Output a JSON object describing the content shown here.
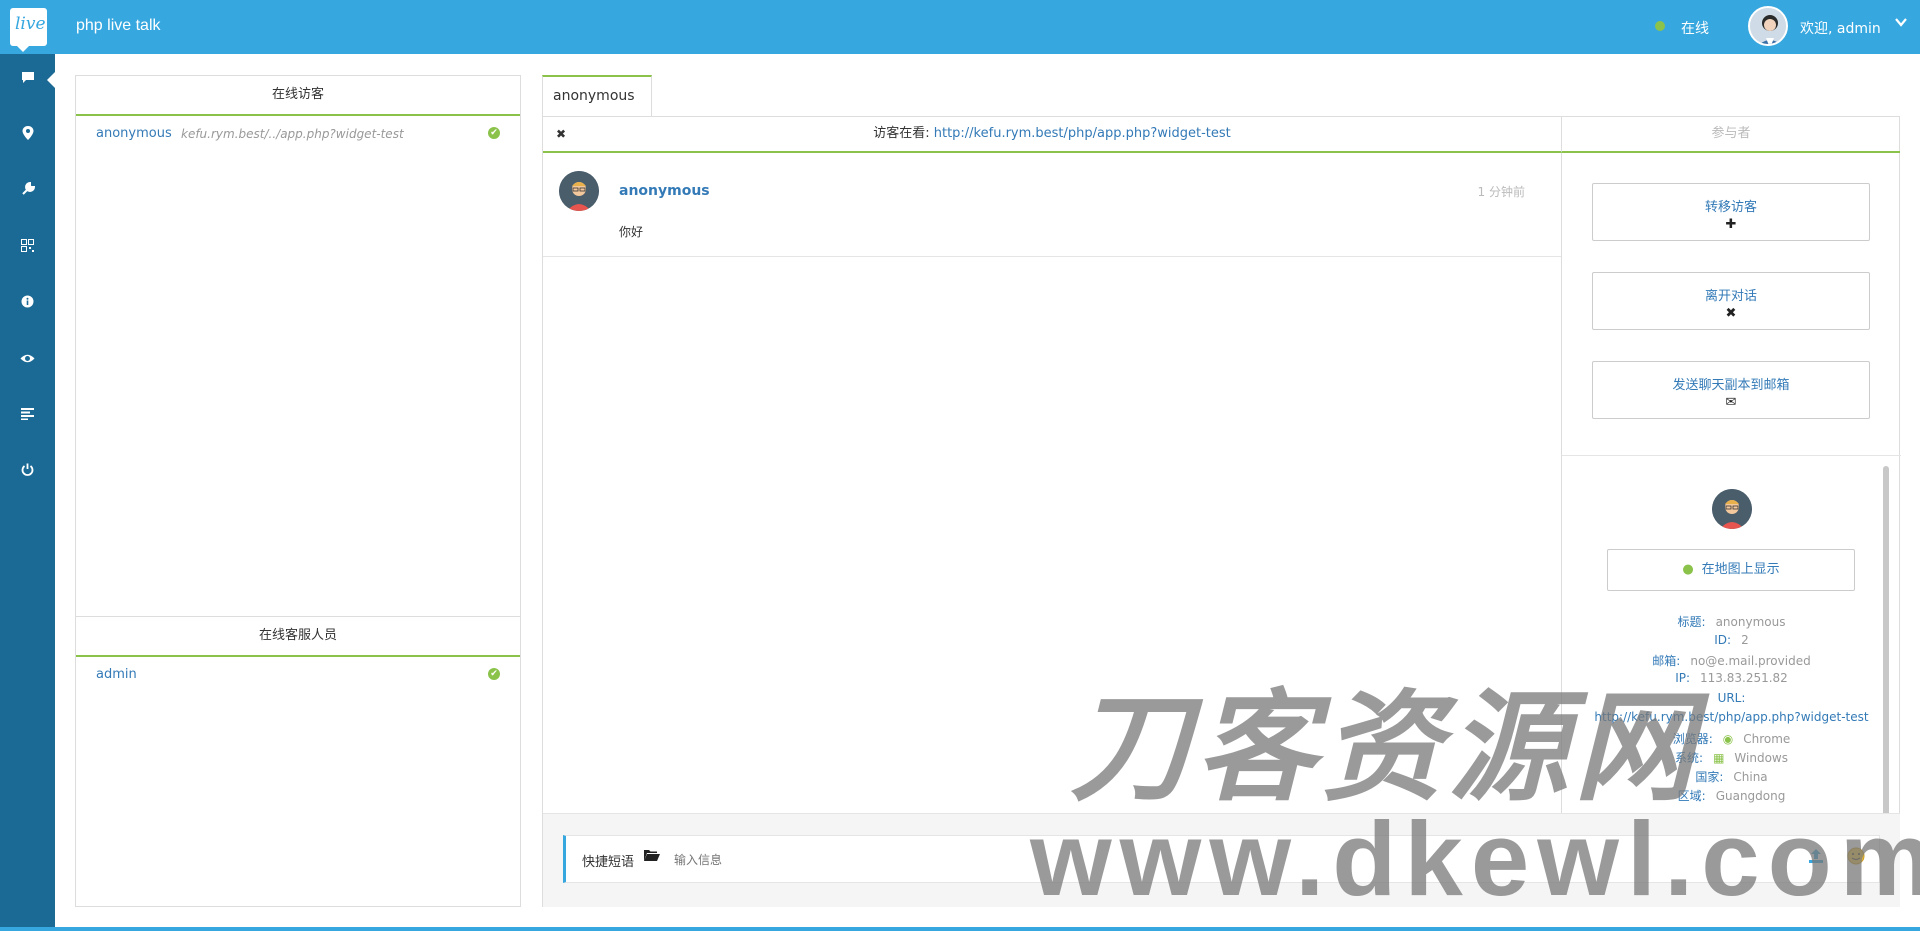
{
  "header": {
    "logo_text": "live",
    "app_title": "php live talk",
    "status": "在线",
    "welcome": "欢迎, admin",
    "chevron": "⌄"
  },
  "sidebar": {
    "items": [
      {
        "icon": "chat-icon",
        "glyph": "▬"
      },
      {
        "icon": "map-pin-icon",
        "glyph": "⚲"
      },
      {
        "icon": "wrench-icon",
        "glyph": "✎"
      },
      {
        "icon": "qr-code-icon",
        "glyph": "▦"
      },
      {
        "icon": "info-icon",
        "glyph": "ⓘ"
      },
      {
        "icon": "eye-icon",
        "glyph": "◉"
      },
      {
        "icon": "list-icon",
        "glyph": "≡"
      },
      {
        "icon": "power-icon",
        "glyph": "⏻"
      }
    ]
  },
  "visitors_panel": {
    "title": "在线访客",
    "items": [
      {
        "name": "anonymous",
        "url": "kefu.rym.best/../app.php?widget-test"
      }
    ]
  },
  "staff_panel": {
    "title": "在线客服人员",
    "items": [
      {
        "name": "admin"
      }
    ]
  },
  "chat": {
    "tab_label": "anonymous",
    "tab_close": "✖",
    "viewing_label": "访客在看:",
    "viewing_url": "http://kefu.rym.best/php/app.php?widget-test",
    "participants_label": "参与者",
    "messages": [
      {
        "name": "anonymous",
        "time": "1 分钟前",
        "text": "你好"
      }
    ]
  },
  "actions": {
    "transfer": {
      "label": "转移访客",
      "glyph": "✚"
    },
    "leave": {
      "label": "离开对话",
      "glyph": "✖"
    },
    "email": {
      "label": "发送聊天副本到邮箱",
      "glyph": "✉"
    }
  },
  "visitor_info": {
    "map_button": "在地图上显示",
    "title_k": "标题:",
    "title_v": "anonymous",
    "id_k": "ID:",
    "id_v": "2",
    "email_k": "邮箱:",
    "email_v": "no@e.mail.provided",
    "ip_k": "IP:",
    "ip_v": "113.83.251.82",
    "url_k": "URL:",
    "url_v": "http://kefu.rym.best/php/app.php?widget-test",
    "browser_k": "浏览器:",
    "browser_v": "Chrome",
    "os_k": "系统:",
    "os_v": "Windows",
    "country_k": "国家:",
    "country_v": "China",
    "region_k": "区域:",
    "region_v": "Guangdong"
  },
  "composer": {
    "quick_label": "快捷短语",
    "placeholder": "输入信息"
  },
  "watermark": {
    "line1": "刀客资源网",
    "line2": "www.dkewl.com"
  },
  "colors": {
    "topbar": "#36a7df",
    "sidebar": "#1a6a95",
    "accent_green": "#8bc34a",
    "link": "#337ab7"
  }
}
